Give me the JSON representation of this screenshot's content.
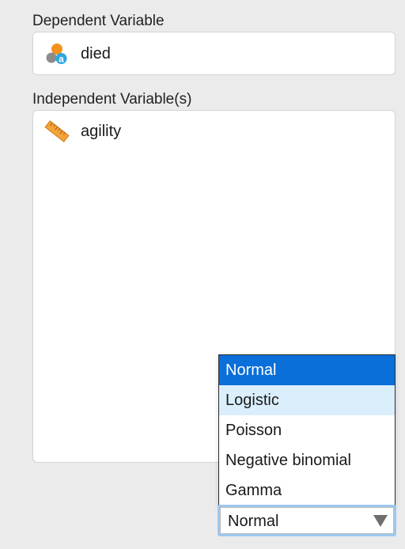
{
  "dependent": {
    "label": "Dependent Variable",
    "variable": {
      "name": "died",
      "icon": "nominal-text-icon"
    }
  },
  "independent": {
    "label": "Independent Variable(s)",
    "variables": [
      {
        "name": "agility",
        "icon": "continuous-ruler-icon"
      }
    ]
  },
  "distribution": {
    "selected": "Normal",
    "highlighted": "Logistic",
    "options": [
      "Normal",
      "Logistic",
      "Poisson",
      "Negative binomial",
      "Gamma"
    ],
    "colors": {
      "selected_bg": "#0a6fd8",
      "highlight_bg": "#daeefc",
      "focus_ring": "#9cc8f0"
    }
  }
}
